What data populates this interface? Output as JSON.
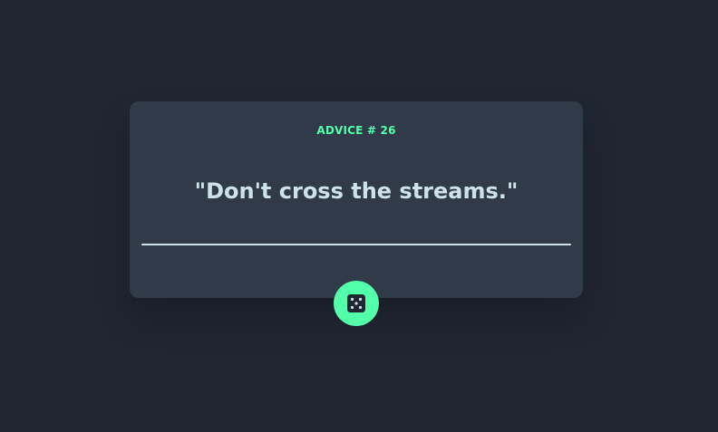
{
  "card": {
    "advice_id_label": "ADVICE # 26",
    "advice_text": "\"Don't cross the streams.\""
  },
  "button": {
    "icon": "dice-icon"
  },
  "colors": {
    "background": "#202632",
    "card": "#313a49",
    "accent": "#53ffaa",
    "text": "#cee3e9"
  }
}
